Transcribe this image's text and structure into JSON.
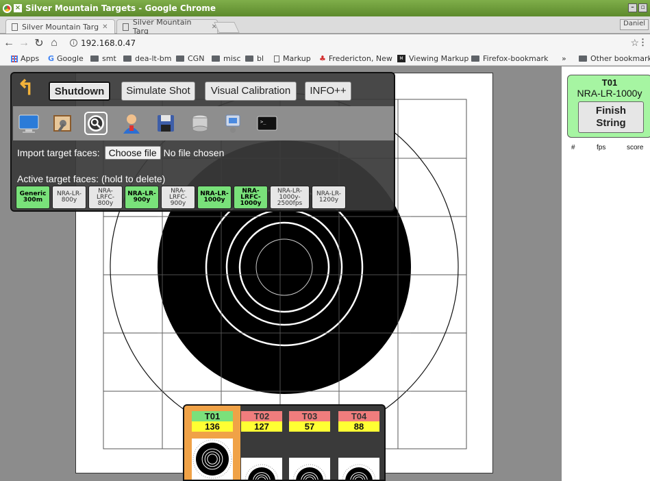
{
  "window": {
    "title": "Silver Mountain Targets - Google Chrome",
    "tabs": [
      "Silver Mountain Targ",
      "Silver Mountain Targ"
    ],
    "profile": "Daniel"
  },
  "toolbar": {
    "url": "192.168.0.47"
  },
  "bookmarks": {
    "items": [
      "Apps",
      "Google",
      "smt",
      "dea-lt-bm",
      "CGN",
      "misc",
      "bl",
      "Markup",
      "Fredericton, New",
      "Viewing Markup",
      "Firefox-bookmark"
    ],
    "overflow": "»",
    "other": "Other bookmarks"
  },
  "panel": {
    "buttons": {
      "shutdown": "Shutdown",
      "simulate": "Simulate Shot",
      "calibration": "Visual Calibration",
      "info": "INFO++"
    },
    "icons": [
      "monitor-icon",
      "picture-settings-icon",
      "zoom-target-icon",
      "user-icon",
      "save-icon",
      "database-icon",
      "network-icon",
      "terminal-icon"
    ],
    "import_label": "Import target faces:",
    "choose_file": "Choose file",
    "no_file": "No file chosen",
    "active_label": "Active target faces: (hold to delete)",
    "faces": [
      {
        "label": "Generic\n300m",
        "active": true
      },
      {
        "label": "NRA-LR-\n800y",
        "active": false
      },
      {
        "label": "NRA-\nLRFC-\n800y",
        "active": false
      },
      {
        "label": "NRA-LR-\n900y",
        "active": true
      },
      {
        "label": "NRA-\nLRFC-\n900y",
        "active": false
      },
      {
        "label": "NRA-LR-\n1000y",
        "active": true
      },
      {
        "label": "NRA-\nLRFC-\n1000y",
        "active": true
      },
      {
        "label": "NRA-LR-\n1000y-\n2500fps",
        "active": false
      },
      {
        "label": "NRA-LR-\n1200y",
        "active": false
      }
    ]
  },
  "lanes": [
    {
      "name": "T01",
      "count": "136",
      "color": "#7be07b",
      "selected": true
    },
    {
      "name": "T02",
      "count": "127",
      "color": "#f07d7d",
      "selected": false
    },
    {
      "name": "T03",
      "count": "57",
      "color": "#f07d7d",
      "selected": false
    },
    {
      "name": "T04",
      "count": "88",
      "color": "#f07d7d",
      "selected": false
    }
  ],
  "sidebar": {
    "lane_title": "T01",
    "lane_face": "NRA-LR-1000y",
    "finish_button": "Finish\nString",
    "columns": [
      "#",
      "fps",
      "score"
    ]
  },
  "colors": {
    "accent_green": "#a6f5a2",
    "active_face": "#79e17a",
    "lane_selected": "#f0a247",
    "count_bg": "#ffff33"
  }
}
